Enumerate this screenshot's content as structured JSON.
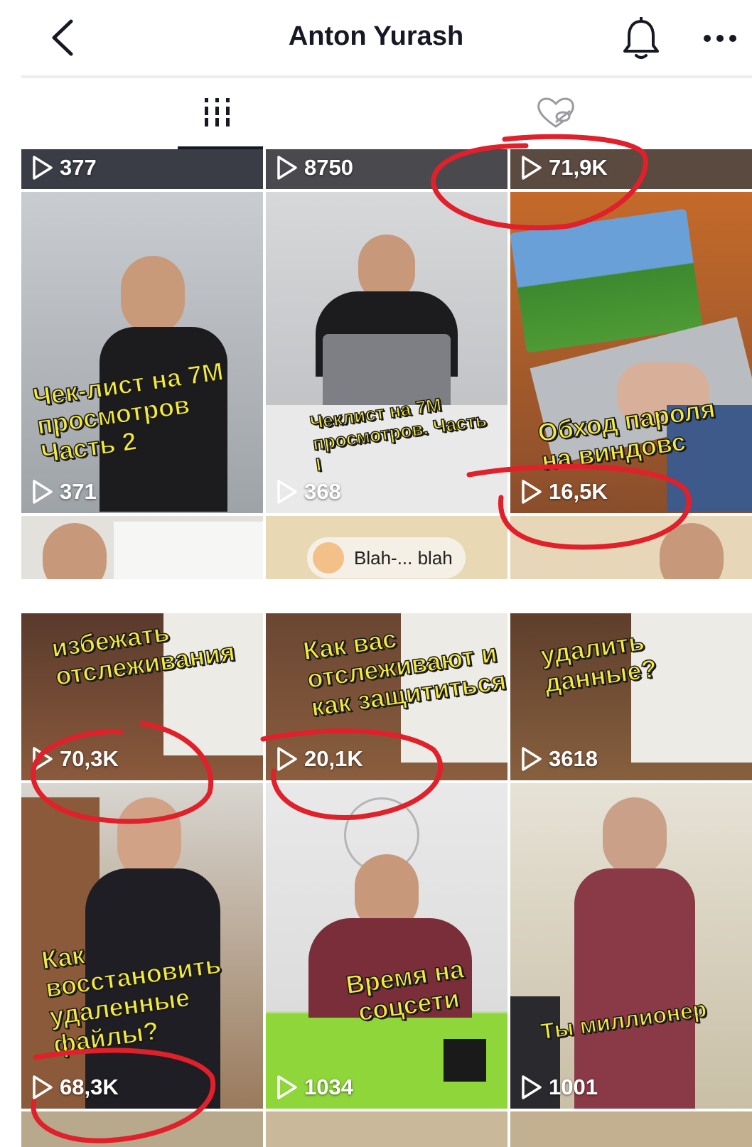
{
  "header": {
    "title": "Anton Yurash",
    "back_icon": "chevron-left-icon",
    "bell_icon": "bell-icon",
    "more_icon": "more-horizontal-icon"
  },
  "tabs": [
    {
      "name": "videos",
      "icon": "grid-icon",
      "active": true
    },
    {
      "name": "liked",
      "icon": "heart-hidden-icon",
      "active": false
    }
  ],
  "grid_top": {
    "row1": [
      "377",
      "8750",
      "71,9K"
    ],
    "row2": [
      {
        "caption": "Чек-лист на 7M просмотров Часть 2",
        "views": "371"
      },
      {
        "caption": "Чеклист на 7M просмотров. Часть I",
        "views": "368"
      },
      {
        "caption": "Обход пароля на виндовс",
        "views": "16,5K"
      }
    ],
    "chip_text": "Blah-... blah"
  },
  "grid_bottom": {
    "row1": [
      {
        "caption": "избежать отслеживания",
        "views": "70,3K"
      },
      {
        "caption": "Как вас отслеживают и как защититься",
        "views": "20,1K"
      },
      {
        "caption": "удалить данные?",
        "views": "3618"
      }
    ],
    "row2": [
      {
        "caption": "Как восстановить удаленные файлы?",
        "views": "68,3K"
      },
      {
        "caption": "Время на соцсети",
        "views": "1034"
      },
      {
        "caption": "Ты миллионер",
        "views": "1001"
      }
    ]
  },
  "colors": {
    "caption_yellow": "#f4ea3c",
    "annotation_red": "#e0202a",
    "text_dark": "#161823"
  }
}
